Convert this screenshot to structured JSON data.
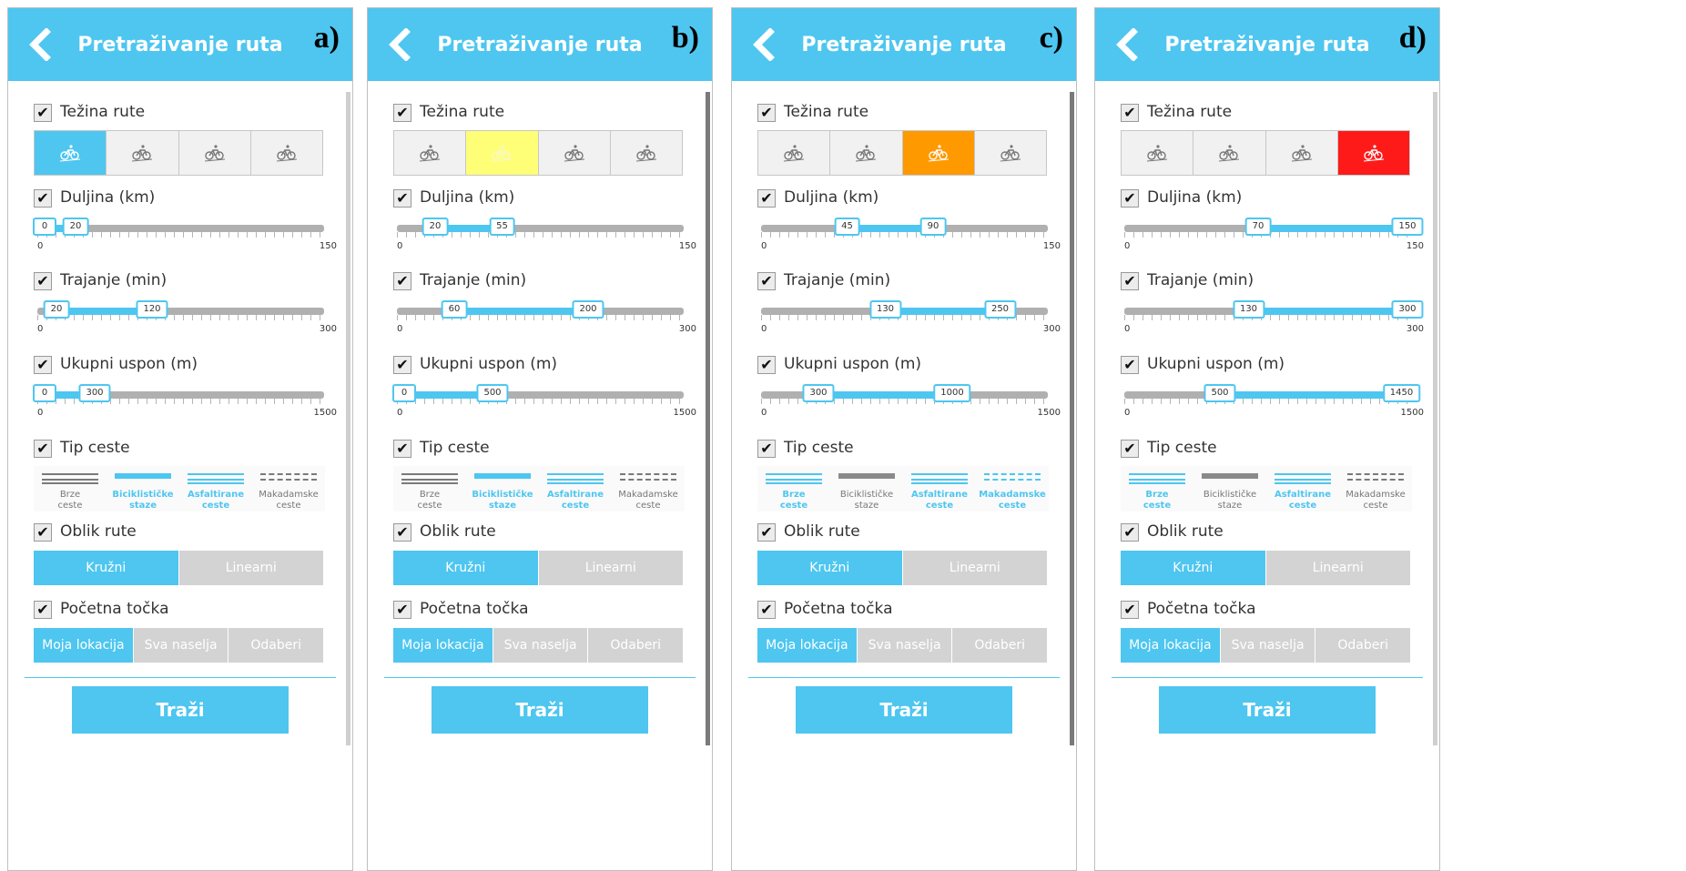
{
  "colors": {
    "accent": "#4ec6f0",
    "easy": "#4ec6f0",
    "moderate": "#ffff77",
    "hard": "#ff9900",
    "very_hard": "#ff1a1a",
    "inactive": "#d3d3d3",
    "road_gray": "#8a8a8a"
  },
  "app": {
    "title": "Pretraživanje ruta",
    "search_label": "Traži",
    "sections": {
      "difficulty": "Težina rute",
      "length": "Duljina (km)",
      "duration": "Trajanje (min)",
      "ascent": "Ukupni uspon (m)",
      "road_type": "Tip ceste",
      "shape": "Oblik rute",
      "start": "Početna točka"
    },
    "road_types": [
      {
        "line1": "Brze",
        "line2": "ceste"
      },
      {
        "line1": "Biciklističke",
        "line2": "staze"
      },
      {
        "line1": "Asfaltirane",
        "line2": "ceste"
      },
      {
        "line1": "Makadamske",
        "line2": "ceste"
      }
    ],
    "shape_options": [
      "Kružni",
      "Linearni"
    ],
    "start_options": [
      "Moja lokacija",
      "Sva naselja",
      "Odaberi"
    ]
  },
  "panels": [
    {
      "label": "a)",
      "difficulty_selected": 0,
      "length": {
        "min": 0,
        "max": 150,
        "low": 0,
        "high": 20
      },
      "duration": {
        "min": 0,
        "max": 300,
        "low": 20,
        "high": 120
      },
      "ascent": {
        "min": 0,
        "max": 1500,
        "low": 0,
        "high": 300
      },
      "road_selected": [
        false,
        true,
        true,
        false
      ],
      "shape_selected": 0,
      "start_selected": 0
    },
    {
      "label": "b)",
      "difficulty_selected": 1,
      "length": {
        "min": 0,
        "max": 150,
        "low": 20,
        "high": 55
      },
      "duration": {
        "min": 0,
        "max": 300,
        "low": 60,
        "high": 200
      },
      "ascent": {
        "min": 0,
        "max": 1500,
        "low": 0,
        "high": 500
      },
      "road_selected": [
        false,
        true,
        true,
        false
      ],
      "shape_selected": 0,
      "start_selected": 0
    },
    {
      "label": "c)",
      "difficulty_selected": 2,
      "length": {
        "min": 0,
        "max": 150,
        "low": 45,
        "high": 90
      },
      "duration": {
        "min": 0,
        "max": 300,
        "low": 130,
        "high": 250
      },
      "ascent": {
        "min": 0,
        "max": 1500,
        "low": 300,
        "high": 1000
      },
      "road_selected": [
        true,
        false,
        true,
        true
      ],
      "shape_selected": 0,
      "start_selected": 0
    },
    {
      "label": "d)",
      "difficulty_selected": 3,
      "length": {
        "min": 0,
        "max": 150,
        "low": 70,
        "high": 150
      },
      "duration": {
        "min": 0,
        "max": 300,
        "low": 130,
        "high": 300
      },
      "ascent": {
        "min": 0,
        "max": 1500,
        "low": 500,
        "high": 1450
      },
      "road_selected": [
        true,
        false,
        true,
        false
      ],
      "shape_selected": 0,
      "start_selected": 0
    }
  ]
}
